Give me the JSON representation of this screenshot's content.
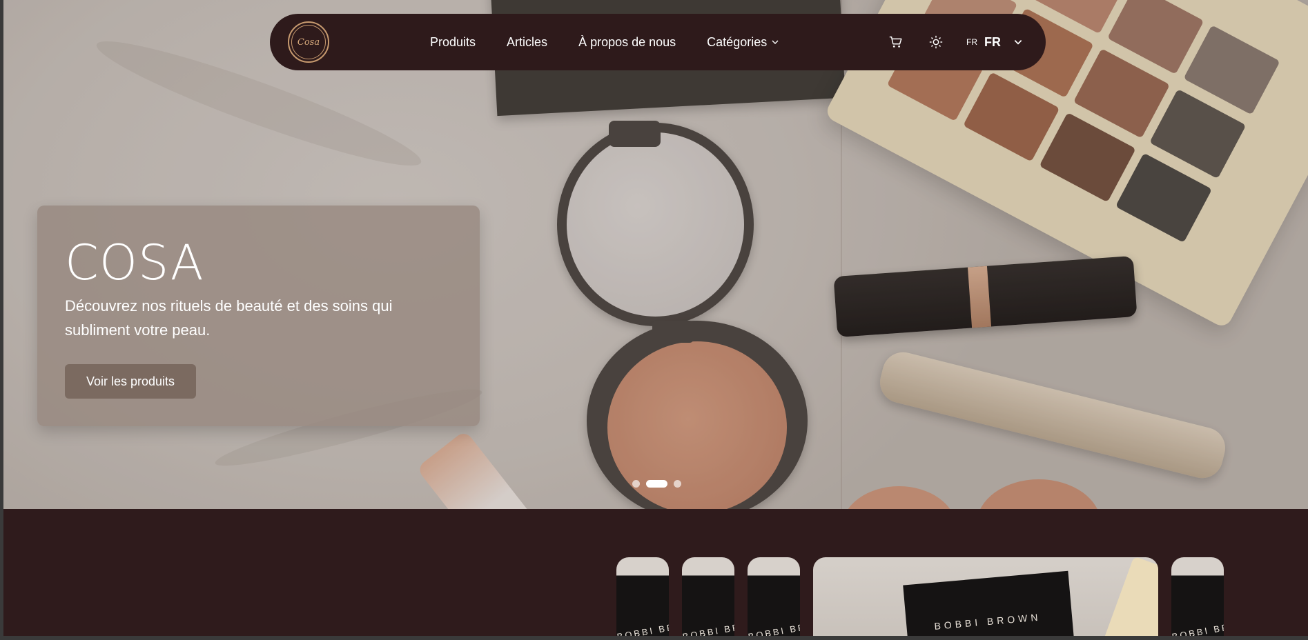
{
  "brand": {
    "logo_text": "Cosa"
  },
  "nav": {
    "links": [
      {
        "label": "Produits"
      },
      {
        "label": "Articles"
      },
      {
        "label": "À propos de nous"
      },
      {
        "label": "Catégories"
      }
    ],
    "lang_small": "FR",
    "lang_big": "FR"
  },
  "hero": {
    "title": "COSA",
    "subtitle": "Découvrez nos rituels de beauté et des soins qui subliment votre peau.",
    "button_label": "Voir les produits",
    "carousel": {
      "slides": 3,
      "active_index": 1
    }
  },
  "thumbnails": [
    {
      "text": "BOBBI BROWN"
    },
    {
      "text": "BOBBI BROWN"
    },
    {
      "text": "BOBBI BROWN"
    },
    {
      "text": "BOBBI BROWN"
    },
    {
      "text": "BOBBI BROWN"
    }
  ],
  "colors": {
    "background": "#2f1b1c",
    "nav_bg": "#2e1a1b",
    "accent": "#c79a6f",
    "card_bg": "#968780",
    "button_bg": "#7b6a60"
  },
  "icons": [
    "cart-icon",
    "sun-icon",
    "chevron-down-icon"
  ]
}
